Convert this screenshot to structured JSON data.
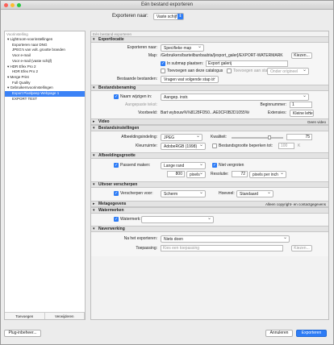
{
  "window": {
    "title": "Eén bestand exporteren"
  },
  "export_to": {
    "label": "Exporteren naar:",
    "value": "Vaste schijf"
  },
  "left": {
    "header": "Voorinstelling",
    "tree": [
      {
        "label": "▾ Lightroom-voorinstellingen",
        "indent": 0
      },
      {
        "label": "Exporteren naar DNG",
        "indent": 1
      },
      {
        "label": "JPEG's van volt. grootte branden",
        "indent": 1
      },
      {
        "label": "Voor e-mail",
        "indent": 1
      },
      {
        "label": "Voor e-mail (vaste schijf)",
        "indent": 1
      },
      {
        "label": "▾ HDR Efex Pro 2",
        "indent": 0
      },
      {
        "label": "HDR Efex Pro 2",
        "indent": 1
      },
      {
        "label": "▾ Merge Print",
        "indent": 0
      },
      {
        "label": "Full Quality",
        "indent": 1
      },
      {
        "label": "▾ Gebruikersvoorinstellingen",
        "indent": 0
      },
      {
        "label": "Export Pixelpeep Webpage 1",
        "indent": 1,
        "selected": true
      },
      {
        "label": "EXPORT TEST",
        "indent": 1
      }
    ],
    "add": "Toevoegen",
    "remove": "Verwijderen"
  },
  "right": {
    "header": "Eén bestand exporteren",
    "sections": {
      "location": {
        "title": "Exportlocatie",
        "export_to_label": "Exporteren naar:",
        "export_to": "Specifieke map",
        "map_label": "Map:",
        "map_path": "/Gebruikers/barteilbunbaubta/[export_galer]/EXPORT-WATERMARK",
        "choose": "Kiezen...",
        "subfolder_label": "In submap plaatsen:",
        "subfolder": "Export galerij",
        "catalog_label": "Toevoegen aan deze catalogus",
        "stack_label": "Toevoegen aan stapel:",
        "stack_value": "Onder origineel",
        "existing_label": "Bestaande bestanden:",
        "existing_value": "Vragen wat volgende stap is"
      },
      "naming": {
        "title": "Bestandsbenaming",
        "rename_label": "Naam wijzigen in:",
        "rename_value": "Aangep. instr.",
        "custom_text_label": "Aangepaste tekst:",
        "start_label": "Beginnummer:",
        "start_value": "1",
        "example_label": "Voorbeeld:",
        "example": "Bart wybouw%%8128FD50...AE0CF0B2D1055%0001.jpg",
        "ext_label": "Extensies:",
        "ext_value": "Kleine letters"
      },
      "video": {
        "title": "Video",
        "right": "Geen video"
      },
      "file": {
        "title": "Bestandsinstellingen",
        "format_label": "Afbeeldingsindeling:",
        "format": "JPEG",
        "quality_label": "Kwaliteit:",
        "quality": "75",
        "quality_level": 0.75,
        "colorspace_label": "Kleurruimte:",
        "colorspace": "AdobeRGB (1998)",
        "limit_label": "Bestandsgrootte beperken tot:",
        "limit_value": "100",
        "limit_unit": "K"
      },
      "size": {
        "title": "Afbeeldingsgrootte",
        "resize_label": "Passend maken:",
        "resize_value": "Lange rand",
        "no_enlarge": "Niet vergroten",
        "size_value": "800",
        "size_unit": "pixels",
        "res_label": "Resolutie:",
        "res_value": "72",
        "res_unit": "pixels per inch"
      },
      "sharpen": {
        "title": "Uitvoer verscherpen",
        "label": "Verscherpen voor:",
        "value": "Scherm",
        "amount_label": "Hoeveel:",
        "amount": "Standaard"
      },
      "metadata": {
        "title": "Metagegevens",
        "right": "Alleen copyright- en contactgegevens"
      },
      "watermark": {
        "title": "Watermerken",
        "label": "Watermerk:"
      },
      "post": {
        "title": "Naverwerking",
        "after_label": "Na het exporteren:",
        "after_value": "Niets doen",
        "app_label": "Toepassing:",
        "app_value": "Kies een toepassing",
        "choose": "Kiezen..."
      }
    }
  },
  "footer": {
    "plugin": "Plug-inbeheer...",
    "cancel": "Annuleren",
    "export": "Exporteren"
  }
}
